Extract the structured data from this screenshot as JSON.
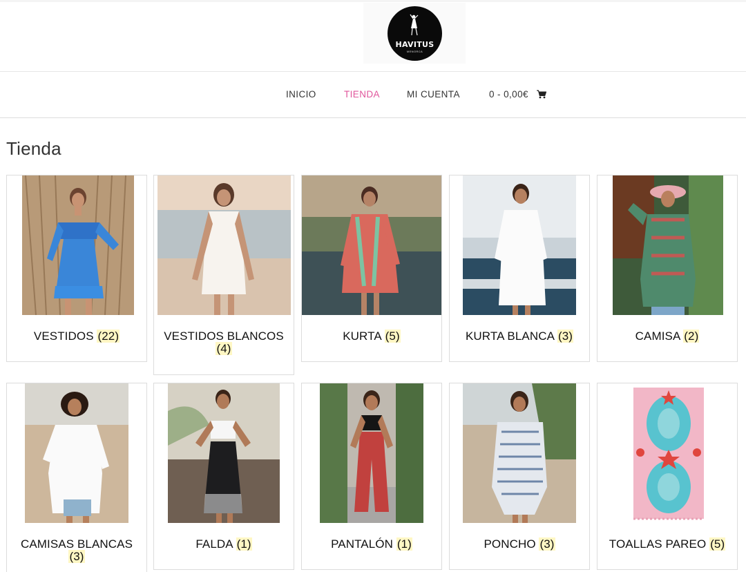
{
  "brand": {
    "name": "HAVITUS",
    "tagline": "MENORCA"
  },
  "nav": {
    "items": [
      {
        "label": "INICIO",
        "active": false
      },
      {
        "label": "TIENDA",
        "active": true
      },
      {
        "label": "MI CUENTA",
        "active": false
      }
    ],
    "cart": {
      "label": "0 - 0,00€",
      "icon": "shopping-cart-icon"
    }
  },
  "page": {
    "title": "Tienda"
  },
  "categories": [
    {
      "name": "VESTIDOS",
      "count": "(22)"
    },
    {
      "name": "VESTIDOS BLANCOS",
      "count": "(4)"
    },
    {
      "name": "KURTA",
      "count": "(5)"
    },
    {
      "name": "KURTA BLANCA",
      "count": "(3)"
    },
    {
      "name": "CAMISA",
      "count": "(2)"
    },
    {
      "name": "CAMISAS BLANCAS",
      "count": "(3)"
    },
    {
      "name": "FALDA",
      "count": "(1)"
    },
    {
      "name": "PANTALÓN",
      "count": "(1)"
    },
    {
      "name": "PONCHO",
      "count": "(3)"
    },
    {
      "name": "TOALLAS PAREO",
      "count": "(5)"
    }
  ],
  "colors": {
    "accent": "#e0559b",
    "count_highlight": "#fff7c4",
    "border": "#dcdcdc",
    "logo_bg": "#0a0a0a"
  }
}
